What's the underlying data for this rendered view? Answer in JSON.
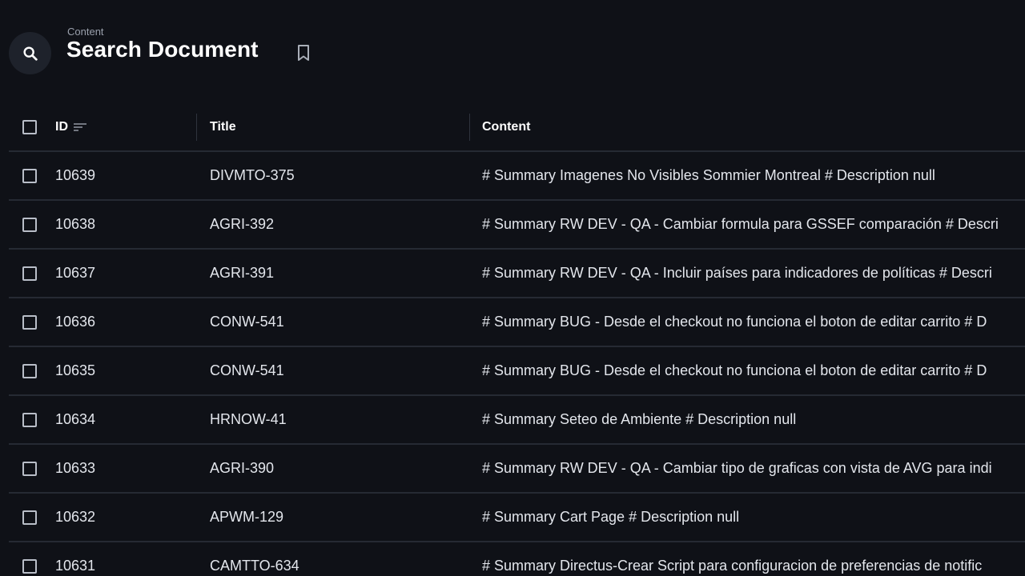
{
  "header": {
    "breadcrumb": "Content",
    "title": "Search Document"
  },
  "table": {
    "columns": {
      "id": "ID",
      "title": "Title",
      "content": "Content"
    },
    "rows": [
      {
        "id": "10639",
        "title": "DIVMTO-375",
        "content": "# Summary Imagenes No Visibles Sommier Montreal # Description null"
      },
      {
        "id": "10638",
        "title": "AGRI-392",
        "content": "# Summary RW DEV - QA - Cambiar formula para GSSEF comparación # Descri"
      },
      {
        "id": "10637",
        "title": "AGRI-391",
        "content": "# Summary RW DEV - QA - Incluir países para indicadores de políticas # Descri"
      },
      {
        "id": "10636",
        "title": "CONW-541",
        "content": "# Summary BUG - Desde el checkout no funciona el boton de editar carrito # D"
      },
      {
        "id": "10635",
        "title": "CONW-541",
        "content": "# Summary BUG - Desde el checkout no funciona el boton de editar carrito # D"
      },
      {
        "id": "10634",
        "title": "HRNOW-41",
        "content": "# Summary Seteo de Ambiente # Description null"
      },
      {
        "id": "10633",
        "title": "AGRI-390",
        "content": "# Summary RW DEV - QA - Cambiar tipo de graficas con vista de AVG para indi"
      },
      {
        "id": "10632",
        "title": "APWM-129",
        "content": "# Summary Cart Page # Description null"
      },
      {
        "id": "10631",
        "title": "CAMTTO-634",
        "content": "# Summary Directus-Crear Script para configuracion de preferencias de notific"
      }
    ]
  },
  "icons": {
    "search": "search-icon",
    "bookmark": "bookmark-icon",
    "sort": "sort-icon",
    "checkbox": "checkbox"
  }
}
